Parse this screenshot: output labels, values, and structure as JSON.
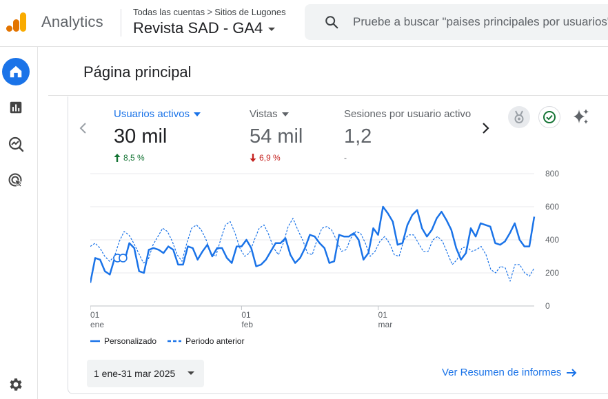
{
  "header": {
    "brand": "Analytics",
    "breadcrumb": {
      "account": "Todas las cuentas",
      "separator": ">",
      "property_group": "Sitios de Lugones"
    },
    "property_name": "Revista SAD - GA4",
    "search_placeholder": "Pruebe a buscar \"paises principales por usuarios\""
  },
  "nav": {
    "items": [
      {
        "name": "home",
        "icon": "home-icon",
        "active": true
      },
      {
        "name": "reports",
        "icon": "bar-chart-icon",
        "active": false
      },
      {
        "name": "explore",
        "icon": "explore-icon",
        "active": false
      },
      {
        "name": "advertising",
        "icon": "advertising-icon",
        "active": false
      }
    ],
    "bottom_icon": "gear-icon"
  },
  "page": {
    "title": "Página principal"
  },
  "metrics": [
    {
      "label": "Usuarios activos",
      "value": "30 mil",
      "change": "8,5 %",
      "direction": "up",
      "selected": true
    },
    {
      "label": "Vistas",
      "value": "54 mil",
      "change": "6,9 %",
      "direction": "down",
      "selected": false
    },
    {
      "label": "Sesiones por usuario activo",
      "value": "1,2",
      "change": "-",
      "direction": "none",
      "selected": false
    }
  ],
  "colors": {
    "accent": "#1a73e8",
    "up": "#137333",
    "down": "#c5221f"
  },
  "chart_data": {
    "type": "line",
    "x_ticks": [
      {
        "day": "01",
        "month": "ene"
      },
      {
        "day": "01",
        "month": "feb"
      },
      {
        "day": "01",
        "month": "mar"
      }
    ],
    "y_ticks": [
      "800",
      "600",
      "400",
      "200",
      "0"
    ],
    "ylim": [
      0,
      800
    ],
    "grid": true,
    "legend_position": "bottom",
    "series": [
      {
        "name": "Personalizado",
        "style": "solid",
        "values": [
          140,
          290,
          280,
          210,
          190,
          290,
          290,
          270,
          380,
          350,
          210,
          200,
          340,
          350,
          340,
          320,
          360,
          340,
          250,
          250,
          360,
          350,
          280,
          330,
          370,
          300,
          350,
          350,
          290,
          260,
          360,
          360,
          400,
          350,
          240,
          250,
          280,
          330,
          380,
          380,
          410,
          310,
          260,
          290,
          350,
          430,
          420,
          380,
          350,
          260,
          270,
          430,
          420,
          420,
          440,
          400,
          280,
          320,
          470,
          430,
          600,
          560,
          510,
          370,
          380,
          490,
          550,
          580,
          470,
          420,
          460,
          530,
          570,
          520,
          460,
          350,
          280,
          320,
          470,
          420,
          500,
          490,
          480,
          380,
          370,
          390,
          440,
          500,
          400,
          360,
          360,
          540
        ]
      },
      {
        "name": "Periodo anterior",
        "style": "dashed",
        "values": [
          360,
          380,
          350,
          300,
          270,
          300,
          390,
          450,
          430,
          380,
          320,
          260,
          280,
          370,
          420,
          470,
          450,
          390,
          310,
          270,
          380,
          470,
          490,
          460,
          400,
          320,
          300,
          400,
          490,
          510,
          440,
          350,
          300,
          320,
          400,
          470,
          490,
          430,
          350,
          310,
          380,
          480,
          530,
          460,
          400,
          320,
          310,
          400,
          470,
          480,
          460,
          400,
          330,
          340,
          410,
          450,
          440,
          380,
          300,
          330,
          390,
          420,
          380,
          310,
          300,
          400,
          430,
          430,
          380,
          330,
          330,
          400,
          420,
          390,
          320,
          250,
          280,
          350,
          360,
          330,
          340,
          360,
          310,
          220,
          200,
          240,
          230,
          150,
          250,
          250,
          200,
          180,
          230
        ]
      }
    ]
  },
  "footer": {
    "date_range": "1 ene-31 mar 2025",
    "report_link": "Ver Resumen de informes"
  }
}
